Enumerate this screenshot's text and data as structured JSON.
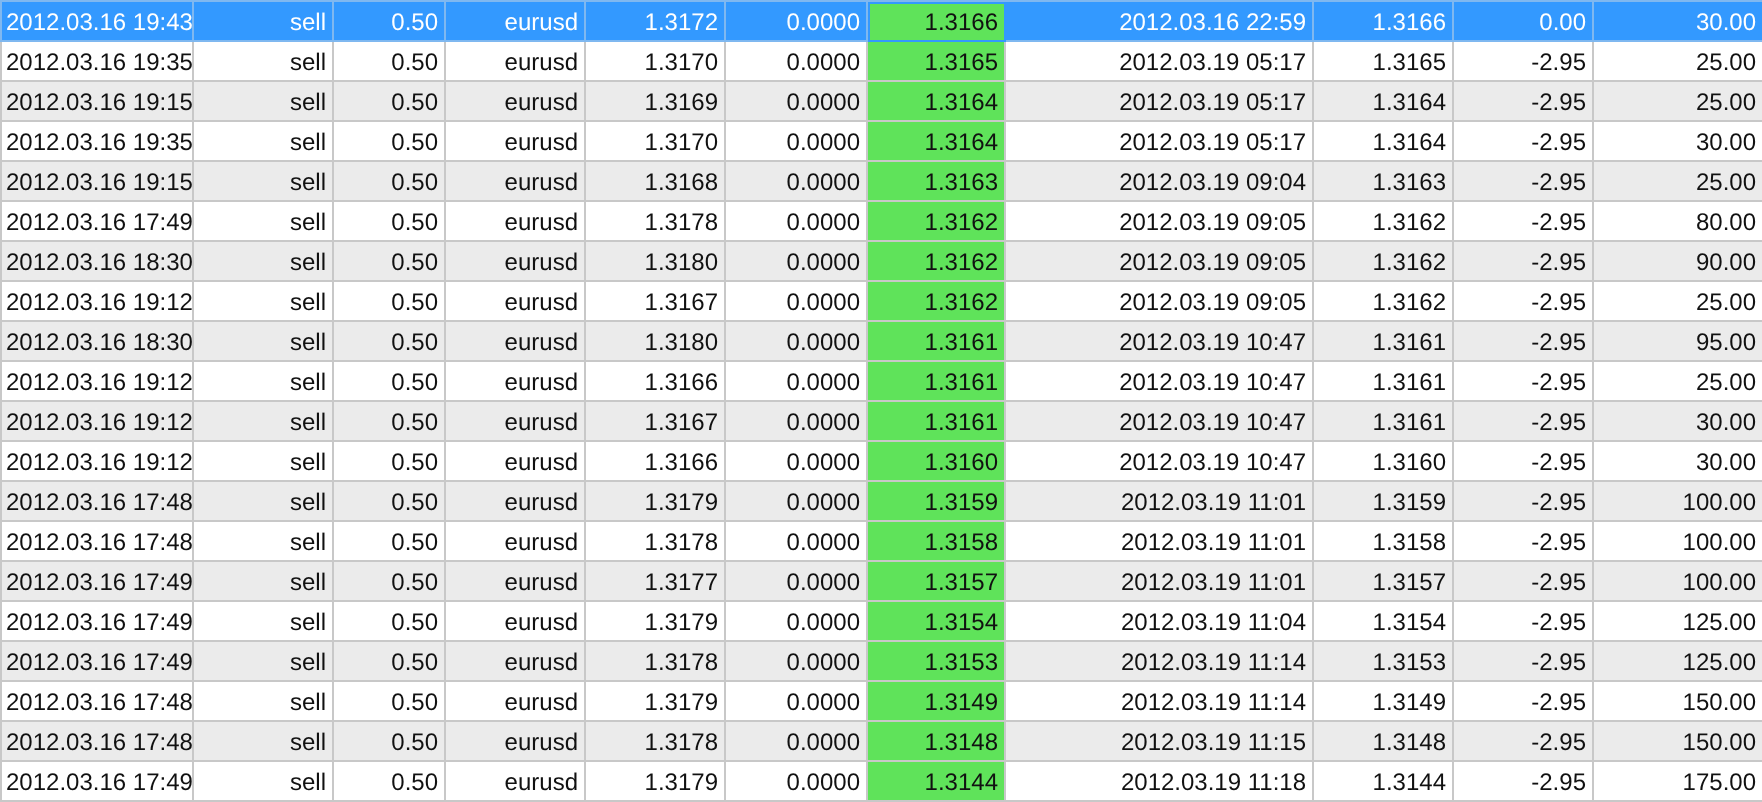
{
  "table": {
    "columns": [
      {
        "highlighted": false
      },
      {
        "highlighted": false
      },
      {
        "highlighted": false
      },
      {
        "highlighted": false
      },
      {
        "highlighted": false
      },
      {
        "highlighted": false
      },
      {
        "highlighted": true
      },
      {
        "highlighted": false
      },
      {
        "highlighted": false
      },
      {
        "highlighted": false
      },
      {
        "highlighted": false
      }
    ],
    "rows": [
      {
        "selected": true,
        "cells": [
          "2012.03.16 19:43",
          "sell",
          "0.50",
          "eurusd",
          "1.3172",
          "0.0000",
          "1.3166",
          "2012.03.16 22:59",
          "1.3166",
          "0.00",
          "30.00"
        ]
      },
      {
        "selected": false,
        "cells": [
          "2012.03.16 19:35",
          "sell",
          "0.50",
          "eurusd",
          "1.3170",
          "0.0000",
          "1.3165",
          "2012.03.19 05:17",
          "1.3165",
          "-2.95",
          "25.00"
        ]
      },
      {
        "selected": false,
        "cells": [
          "2012.03.16 19:15",
          "sell",
          "0.50",
          "eurusd",
          "1.3169",
          "0.0000",
          "1.3164",
          "2012.03.19 05:17",
          "1.3164",
          "-2.95",
          "25.00"
        ]
      },
      {
        "selected": false,
        "cells": [
          "2012.03.16 19:35",
          "sell",
          "0.50",
          "eurusd",
          "1.3170",
          "0.0000",
          "1.3164",
          "2012.03.19 05:17",
          "1.3164",
          "-2.95",
          "30.00"
        ]
      },
      {
        "selected": false,
        "cells": [
          "2012.03.16 19:15",
          "sell",
          "0.50",
          "eurusd",
          "1.3168",
          "0.0000",
          "1.3163",
          "2012.03.19 09:04",
          "1.3163",
          "-2.95",
          "25.00"
        ]
      },
      {
        "selected": false,
        "cells": [
          "2012.03.16 17:49",
          "sell",
          "0.50",
          "eurusd",
          "1.3178",
          "0.0000",
          "1.3162",
          "2012.03.19 09:05",
          "1.3162",
          "-2.95",
          "80.00"
        ]
      },
      {
        "selected": false,
        "cells": [
          "2012.03.16 18:30",
          "sell",
          "0.50",
          "eurusd",
          "1.3180",
          "0.0000",
          "1.3162",
          "2012.03.19 09:05",
          "1.3162",
          "-2.95",
          "90.00"
        ]
      },
      {
        "selected": false,
        "cells": [
          "2012.03.16 19:12",
          "sell",
          "0.50",
          "eurusd",
          "1.3167",
          "0.0000",
          "1.3162",
          "2012.03.19 09:05",
          "1.3162",
          "-2.95",
          "25.00"
        ]
      },
      {
        "selected": false,
        "cells": [
          "2012.03.16 18:30",
          "sell",
          "0.50",
          "eurusd",
          "1.3180",
          "0.0000",
          "1.3161",
          "2012.03.19 10:47",
          "1.3161",
          "-2.95",
          "95.00"
        ]
      },
      {
        "selected": false,
        "cells": [
          "2012.03.16 19:12",
          "sell",
          "0.50",
          "eurusd",
          "1.3166",
          "0.0000",
          "1.3161",
          "2012.03.19 10:47",
          "1.3161",
          "-2.95",
          "25.00"
        ]
      },
      {
        "selected": false,
        "cells": [
          "2012.03.16 19:12",
          "sell",
          "0.50",
          "eurusd",
          "1.3167",
          "0.0000",
          "1.3161",
          "2012.03.19 10:47",
          "1.3161",
          "-2.95",
          "30.00"
        ]
      },
      {
        "selected": false,
        "cells": [
          "2012.03.16 19:12",
          "sell",
          "0.50",
          "eurusd",
          "1.3166",
          "0.0000",
          "1.3160",
          "2012.03.19 10:47",
          "1.3160",
          "-2.95",
          "30.00"
        ]
      },
      {
        "selected": false,
        "cells": [
          "2012.03.16 17:48",
          "sell",
          "0.50",
          "eurusd",
          "1.3179",
          "0.0000",
          "1.3159",
          "2012.03.19 11:01",
          "1.3159",
          "-2.95",
          "100.00"
        ]
      },
      {
        "selected": false,
        "cells": [
          "2012.03.16 17:48",
          "sell",
          "0.50",
          "eurusd",
          "1.3178",
          "0.0000",
          "1.3158",
          "2012.03.19 11:01",
          "1.3158",
          "-2.95",
          "100.00"
        ]
      },
      {
        "selected": false,
        "cells": [
          "2012.03.16 17:49",
          "sell",
          "0.50",
          "eurusd",
          "1.3177",
          "0.0000",
          "1.3157",
          "2012.03.19 11:01",
          "1.3157",
          "-2.95",
          "100.00"
        ]
      },
      {
        "selected": false,
        "cells": [
          "2012.03.16 17:49",
          "sell",
          "0.50",
          "eurusd",
          "1.3179",
          "0.0000",
          "1.3154",
          "2012.03.19 11:04",
          "1.3154",
          "-2.95",
          "125.00"
        ]
      },
      {
        "selected": false,
        "cells": [
          "2012.03.16 17:49",
          "sell",
          "0.50",
          "eurusd",
          "1.3178",
          "0.0000",
          "1.3153",
          "2012.03.19 11:14",
          "1.3153",
          "-2.95",
          "125.00"
        ]
      },
      {
        "selected": false,
        "cells": [
          "2012.03.16 17:48",
          "sell",
          "0.50",
          "eurusd",
          "1.3179",
          "0.0000",
          "1.3149",
          "2012.03.19 11:14",
          "1.3149",
          "-2.95",
          "150.00"
        ]
      },
      {
        "selected": false,
        "cells": [
          "2012.03.16 17:48",
          "sell",
          "0.50",
          "eurusd",
          "1.3178",
          "0.0000",
          "1.3148",
          "2012.03.19 11:15",
          "1.3148",
          "-2.95",
          "150.00"
        ]
      },
      {
        "selected": false,
        "cells": [
          "2012.03.16 17:49",
          "sell",
          "0.50",
          "eurusd",
          "1.3179",
          "0.0000",
          "1.3144",
          "2012.03.19 11:18",
          "1.3144",
          "-2.95",
          "175.00"
        ]
      }
    ]
  }
}
